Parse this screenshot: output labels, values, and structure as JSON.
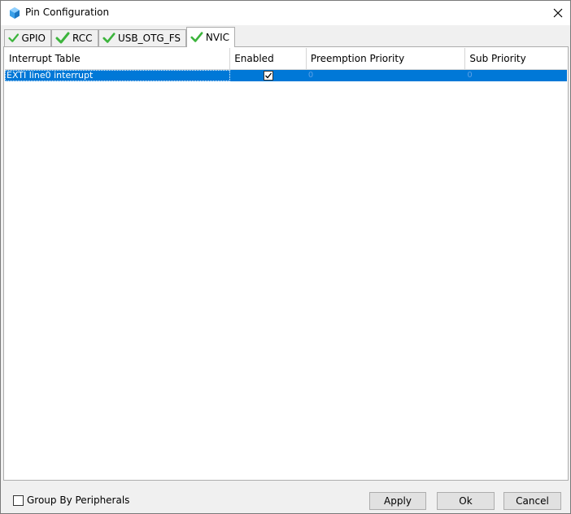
{
  "window": {
    "title": "Pin Configuration"
  },
  "tabs": [
    {
      "label": "GPIO",
      "active": false
    },
    {
      "label": "RCC",
      "active": false
    },
    {
      "label": "USB_OTG_FS",
      "active": false
    },
    {
      "label": "NVIC",
      "active": true
    }
  ],
  "table": {
    "columns": [
      "Interrupt Table",
      "Enabled",
      "Preemption Priority",
      "Sub Priority"
    ],
    "rows": [
      {
        "name": "EXTI line0 interrupt",
        "enabled": true,
        "preemption": "0",
        "sub": "0"
      }
    ]
  },
  "footer": {
    "group_by_label": "Group By Peripherals",
    "group_by_checked": false,
    "apply_label": "Apply",
    "ok_label": "Ok",
    "cancel_label": "Cancel"
  },
  "colors": {
    "selection": "#0078d7",
    "check_green": "#3cb43c"
  }
}
